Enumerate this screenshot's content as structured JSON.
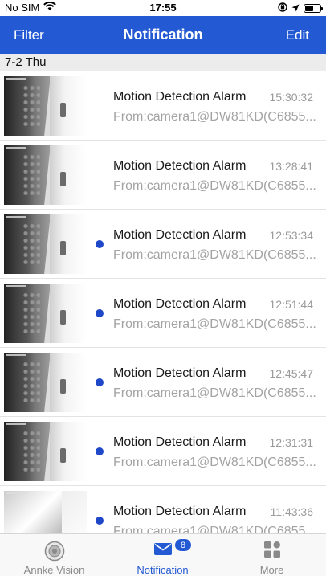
{
  "status_bar": {
    "carrier": "No SIM",
    "time": "17:55"
  },
  "nav": {
    "left_label": "Filter",
    "title": "Notification",
    "right_label": "Edit"
  },
  "date_header": "7-2 Thu",
  "rows": [
    {
      "title": "Motion Detection Alarm",
      "time": "15:30:32",
      "subtitle": "From:camera1@DW81KD(C6855...",
      "unread": false
    },
    {
      "title": "Motion Detection Alarm",
      "time": "13:28:41",
      "subtitle": "From:camera1@DW81KD(C6855...",
      "unread": false
    },
    {
      "title": "Motion Detection Alarm",
      "time": "12:53:34",
      "subtitle": "From:camera1@DW81KD(C6855...",
      "unread": true
    },
    {
      "title": "Motion Detection Alarm",
      "time": "12:51:44",
      "subtitle": "From:camera1@DW81KD(C6855...",
      "unread": true
    },
    {
      "title": "Motion Detection Alarm",
      "time": "12:45:47",
      "subtitle": "From:camera1@DW81KD(C6855...",
      "unread": true
    },
    {
      "title": "Motion Detection Alarm",
      "time": "12:31:31",
      "subtitle": "From:camera1@DW81KD(C6855...",
      "unread": true
    },
    {
      "title": "Motion Detection Alarm",
      "time": "11:43:36",
      "subtitle": "From:camera1@DW81KD(C6855...",
      "unread": true
    }
  ],
  "tabs": [
    {
      "label": "Annke Vision",
      "icon": "camera-lens-icon"
    },
    {
      "label": "Notification",
      "icon": "envelope-icon",
      "badge": "8"
    },
    {
      "label": "More",
      "icon": "more-grid-icon"
    }
  ],
  "colors": {
    "accent": "#2359d3",
    "unread_dot": "#1e48c7"
  }
}
